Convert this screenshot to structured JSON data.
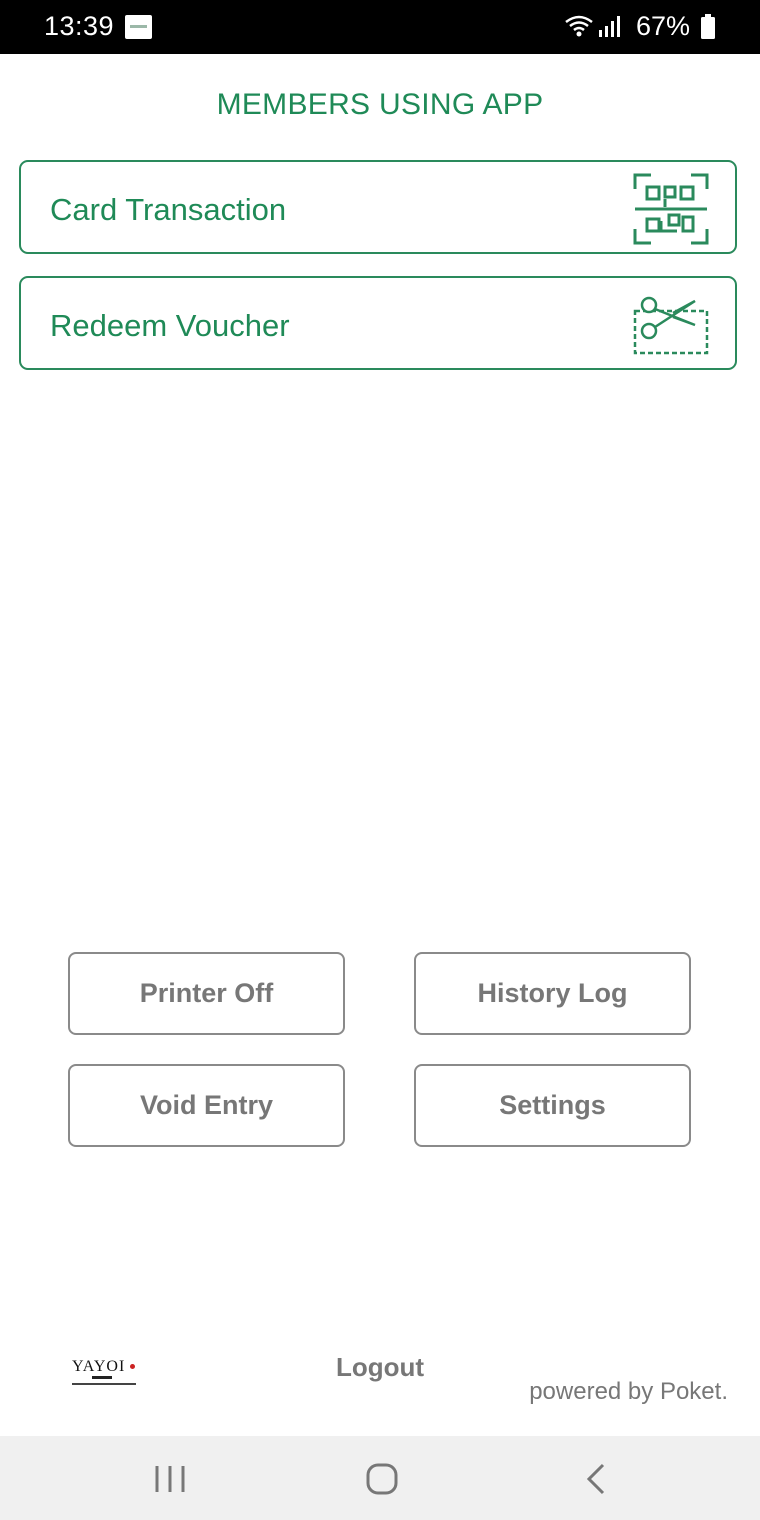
{
  "status_bar": {
    "time": "13:39",
    "battery": "67%",
    "icons": [
      "app-notification-icon",
      "wifi-icon",
      "signal-icon",
      "battery-icon"
    ]
  },
  "header": {
    "title": "MEMBERS USING APP"
  },
  "actions": [
    {
      "label": "Card Transaction",
      "icon": "qr-code-icon"
    },
    {
      "label": "Redeem Voucher",
      "icon": "scissors-coupon-icon"
    }
  ],
  "buttons": {
    "printer": "Printer Off",
    "history": "History Log",
    "void": "Void Entry",
    "settings": "Settings"
  },
  "footer": {
    "brand": "YAYOI",
    "logout": "Logout",
    "powered_by": "powered by Poket."
  },
  "nav": {
    "icons": [
      "recents-icon",
      "home-icon",
      "back-icon"
    ]
  },
  "colors": {
    "accent": "#1f8a57",
    "border_green": "#2a8a5c",
    "gray_text": "#777777",
    "nav_bg": "#f0f0f0"
  }
}
